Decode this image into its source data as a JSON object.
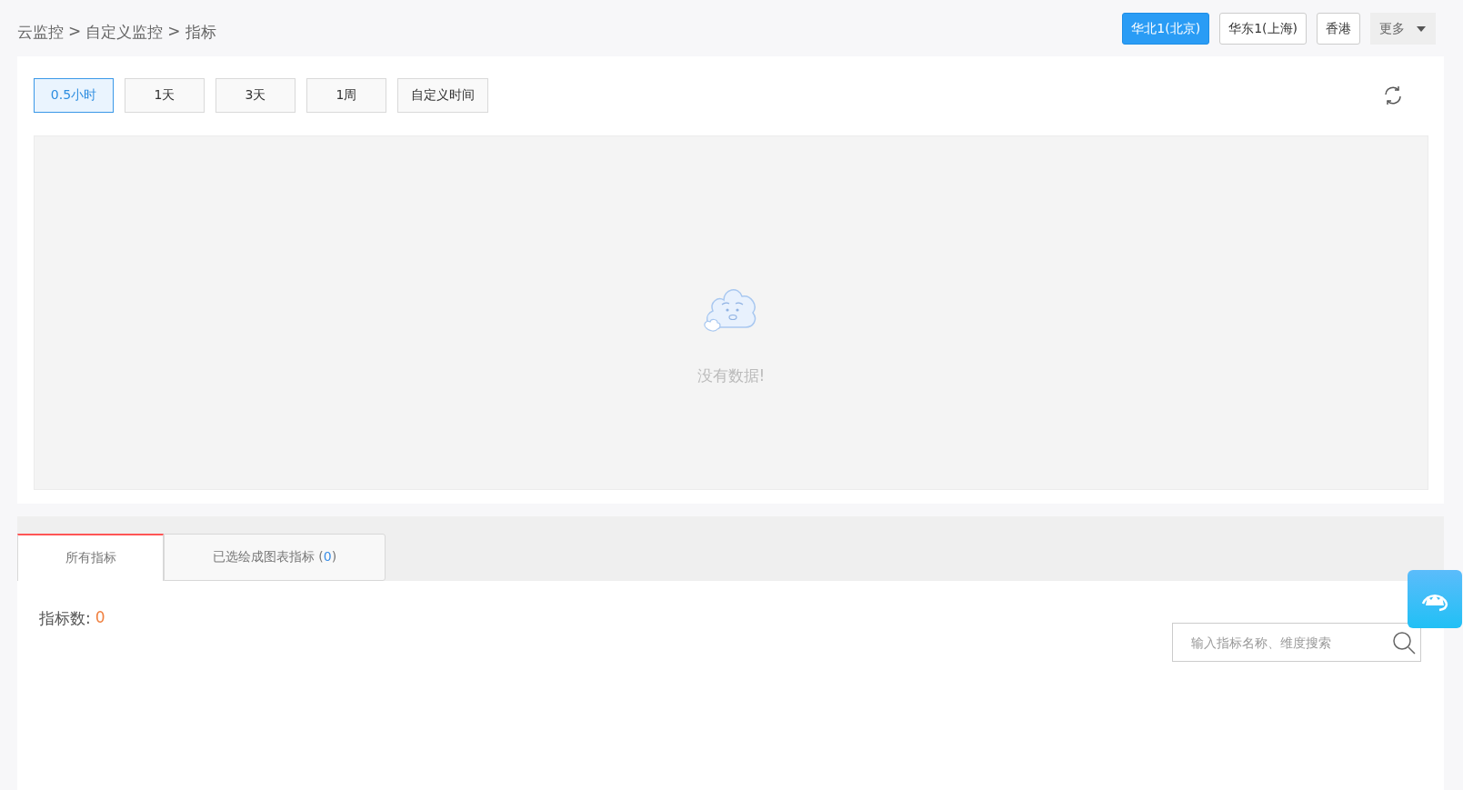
{
  "breadcrumb": {
    "items": [
      "云监控",
      "自定义监控",
      "指标"
    ],
    "separator": ">"
  },
  "regions": [
    {
      "label": "华北1(北京)",
      "selected": true
    },
    {
      "label": "华东1(上海)",
      "selected": false
    },
    {
      "label": "香港",
      "selected": false
    }
  ],
  "more_menu": {
    "label": "更多"
  },
  "time_ranges": [
    {
      "label": "0.5小时",
      "selected": true
    },
    {
      "label": "1天",
      "selected": false
    },
    {
      "label": "3天",
      "selected": false
    },
    {
      "label": "1周",
      "selected": false
    },
    {
      "label": "自定义时间",
      "selected": false
    }
  ],
  "chart_area": {
    "empty_message": "没有数据!"
  },
  "tabs": [
    {
      "label": "所有指标",
      "selected": true
    },
    {
      "label": "已选绘成图表指标 (",
      "count": "0",
      "label_end": ")",
      "selected": false
    }
  ],
  "metric_count": {
    "label": "指标数:",
    "value": "0"
  },
  "search": {
    "placeholder": "输入指标名称、维度搜索"
  }
}
